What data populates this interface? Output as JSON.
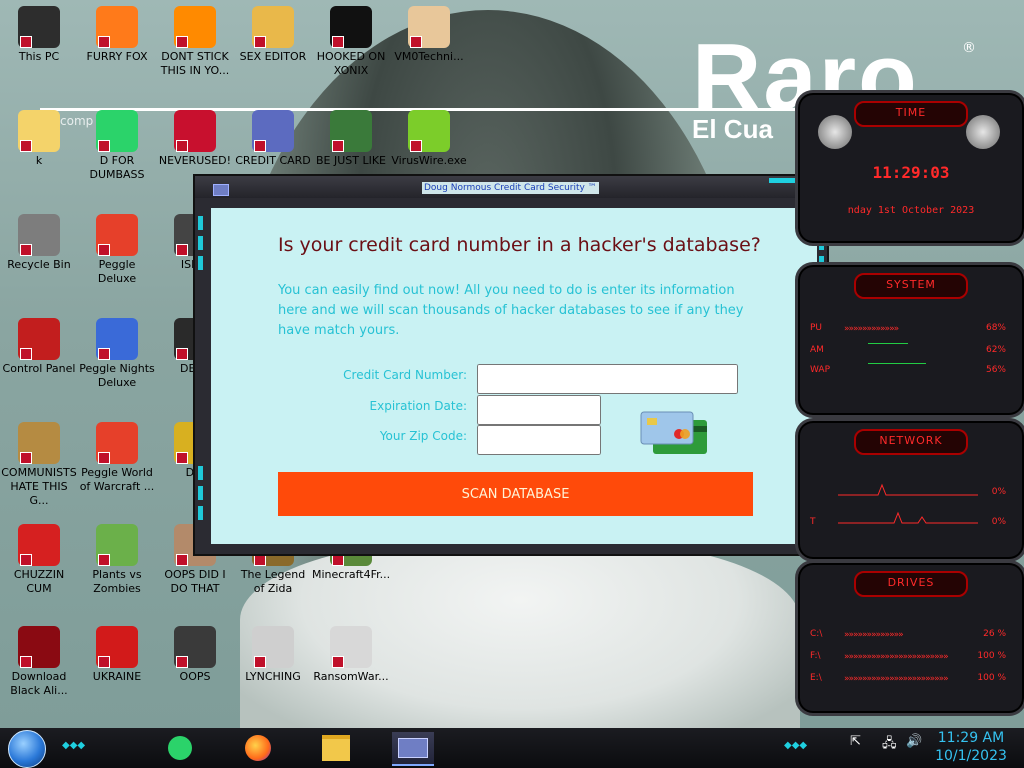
{
  "wallpaper": {
    "brand": "Raro",
    "registered": "®",
    "subtitle": "El Cua",
    "faint_text": "comp   nos"
  },
  "desktop_icons": [
    {
      "label": "This PC",
      "icon": "monitor-icon",
      "color": "#2d2d2d"
    },
    {
      "label": "FURRY FOX",
      "icon": "firefox-icon",
      "color": "#ff7a1a"
    },
    {
      "label": "DONT STICK THIS IN YO...",
      "icon": "vlc-cone-icon",
      "color": "#ff8a00"
    },
    {
      "label": "SEX EDITOR",
      "icon": "hxd-icon",
      "color": "#e9b84a"
    },
    {
      "label": "HOOKED ON XONIX",
      "icon": "xonix-icon",
      "color": "#111111"
    },
    {
      "label": "VM0Techni...",
      "icon": "doctor-icon",
      "color": "#e8c79a"
    },
    {
      "label": "k",
      "icon": "cartoon-girl-icon",
      "color": "#f4d36a"
    },
    {
      "label": "D FOR DUMBASS",
      "icon": "speech-bubble-icon",
      "color": "#2bd36a"
    },
    {
      "label": "NEVERUSED!",
      "icon": "devcpp-icon",
      "color": "#c8102e"
    },
    {
      "label": "CREDIT CARD",
      "icon": "credit-card-icon",
      "color": "#5c6bc0"
    },
    {
      "label": "BE JUST LIKE",
      "icon": "santa-icon",
      "color": "#3a7a3a"
    },
    {
      "label": "VirusWire.exe",
      "icon": "lime-icon",
      "color": "#7ccd2a"
    },
    {
      "label": "Recycle Bin",
      "icon": "recycle-bin-icon",
      "color": "#7d7d7d"
    },
    {
      "label": "Peggle Deluxe",
      "icon": "peggle-icon",
      "color": "#e6402a"
    },
    {
      "label": "ISRAI",
      "icon": "generic-app-icon",
      "color": "#444444"
    },
    {
      "label": "Control Panel",
      "icon": "control-panel-icon",
      "color": "#c21e1e"
    },
    {
      "label": "Peggle Nights Deluxe",
      "icon": "peggle-nights-icon",
      "color": "#3a6ad8"
    },
    {
      "label": "DEEZ",
      "icon": "generic-app-icon",
      "color": "#2a2a2a"
    },
    {
      "label": "COMMUNISTS HATE THIS G...",
      "icon": "money-bag-icon",
      "color": "#b58b42"
    },
    {
      "label": "Peggle World of Warcraft ...",
      "icon": "peggle-wow-icon",
      "color": "#e6402a"
    },
    {
      "label": "DIE",
      "icon": "generic-app-icon",
      "color": "#d8b020"
    },
    {
      "label": "CHUZZIN CUM",
      "icon": "chuzzle-icon",
      "color": "#d62020"
    },
    {
      "label": "Plants vs Zombies",
      "icon": "pvz-icon",
      "color": "#6bb04a"
    },
    {
      "label": "OOPS DID I DO THAT",
      "icon": "face-icon",
      "color": "#b38a6a"
    },
    {
      "label": "The Legend of Zida",
      "icon": "zelda-icon",
      "color": "#8a6a2a"
    },
    {
      "label": "Minecraft4Fr...",
      "icon": "minecraft-icon",
      "color": "#5a8a3a"
    },
    {
      "label": "Download Black Ali...",
      "icon": "alien-ball-icon",
      "color": "#8a0a12"
    },
    {
      "label": "UKRAINE",
      "icon": "radiation-icon",
      "color": "#d21a1a"
    },
    {
      "label": "OOPS",
      "icon": "oops-icon",
      "color": "#3a3a3a"
    },
    {
      "label": "LYNCHING",
      "icon": "noose-icon",
      "color": "#cfcfcf"
    },
    {
      "label": "RansomWar...",
      "icon": "skull-icon",
      "color": "#d8d8d8"
    }
  ],
  "window": {
    "title": "Doug Normous Credit Card Security ™",
    "heading": "Is your credit card number in a hacker's database?",
    "description": "You can easily find out now! All you need to do is enter its information here and we will scan thousands of hacker databases to see if any they have match yours.",
    "fields": [
      {
        "label": "Credit Card Number:",
        "value": ""
      },
      {
        "label": "Expiration Date:",
        "value": ""
      },
      {
        "label": "Your Zip Code:",
        "value": ""
      }
    ],
    "button": "SCAN DATABASE"
  },
  "gadgets": {
    "time": {
      "header": "TIME",
      "clock": "11:29:03",
      "date": "nday 1st October 2023"
    },
    "system": {
      "header": "SYSTEM",
      "rows": [
        {
          "key": "PU",
          "bar": "»»»»»»»»»»»»",
          "value": "68%"
        },
        {
          "key": "AM",
          "bar": "",
          "value": "62%"
        },
        {
          "key": "WAP",
          "bar": "",
          "value": "56%"
        }
      ]
    },
    "network": {
      "header": "NETWORK",
      "rows": [
        {
          "key": "",
          "bar": "",
          "value": "0%"
        },
        {
          "key": "T",
          "bar": "",
          "value": "0%"
        }
      ]
    },
    "drives": {
      "header": "DRIVES",
      "rows": [
        {
          "key": "C:\\",
          "bar": "»»»»»»»»»»»»»",
          "value": "26 %"
        },
        {
          "key": "F:\\",
          "bar": "»»»»»»»»»»»»»»»»»»»»»»»",
          "value": "100 %"
        },
        {
          "key": "E:\\",
          "bar": "»»»»»»»»»»»»»»»»»»»»»»»",
          "value": "100 %"
        }
      ]
    }
  },
  "taskbar": {
    "time": "11:29 AM",
    "date": "10/1/2023"
  }
}
